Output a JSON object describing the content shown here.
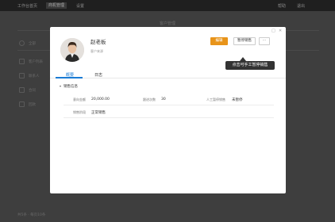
{
  "topbar": {
    "items": [
      "工作台首页",
      "商机管理",
      "设置"
    ],
    "right": [
      "帮助",
      "退出"
    ]
  },
  "page_title": "客户管理",
  "background_rows": [
    "全部",
    "客户列表",
    "联系人",
    "合同",
    "回款"
  ],
  "footer": "共5条 · 每页10条",
  "modal": {
    "window_controls": [
      "□",
      "✕"
    ],
    "customer_name": "赵老板",
    "customer_subtitle": "客户来源",
    "buttons": {
      "primary": "编辑",
      "pause_sale": "暂停销售",
      "more": "···"
    },
    "tooltip": "点击可手工暂停销售",
    "tabs": [
      "概要",
      "日志"
    ],
    "section_title": "销售信息",
    "fields": [
      {
        "label": "意向金额",
        "value": "20,000.00"
      },
      {
        "label": "跟进次数",
        "value": "30"
      },
      {
        "label": "人工暂停销售",
        "value": "未暂停"
      },
      {
        "label": "销售阶段",
        "value": "正常销售"
      }
    ]
  },
  "icons": {
    "section_toggle": "triangle-down"
  }
}
